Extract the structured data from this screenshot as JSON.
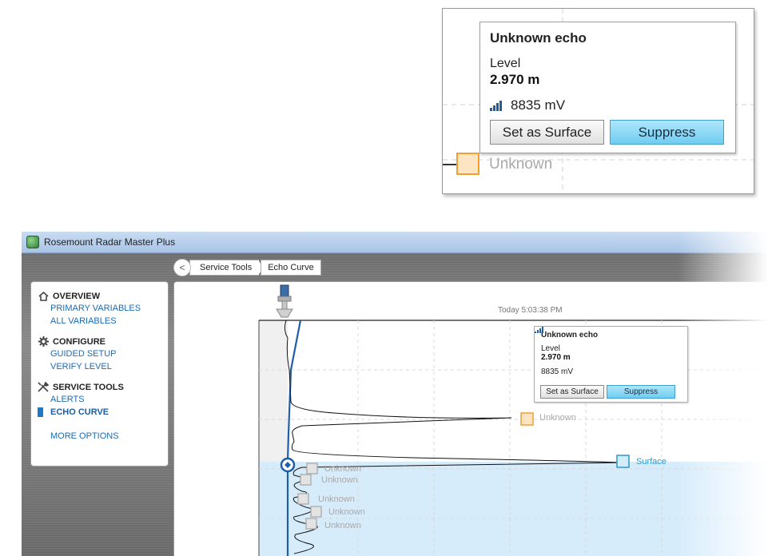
{
  "zoom_tooltip": {
    "title": "Unknown echo",
    "level_label": "Level",
    "level_value": "2.970 m",
    "signal_value": "8835 mV",
    "set_surface_label": "Set as Surface",
    "suppress_label": "Suppress",
    "marker_label": "Unknown"
  },
  "window": {
    "title": "Rosemount Radar Master Plus"
  },
  "breadcrumb": {
    "back_label": "<",
    "items": [
      "Service Tools",
      "Echo Curve"
    ]
  },
  "sidebar": {
    "overview": {
      "heading": "OVERVIEW",
      "links": [
        "PRIMARY VARIABLES",
        "ALL VARIABLES"
      ]
    },
    "configure": {
      "heading": "CONFIGURE",
      "links": [
        "GUIDED SETUP",
        "VERIFY LEVEL"
      ]
    },
    "service_tools": {
      "heading": "SERVICE TOOLS",
      "links": [
        "ALERTS",
        "ECHO CURVE"
      ],
      "active": "ECHO CURVE"
    },
    "more_options": "MORE OPTIONS"
  },
  "echo_chart": {
    "timestamp": "Today 5:03:38 PM",
    "tooltip": {
      "title": "Unknown echo",
      "level_label": "Level",
      "level_value": "2.970 m",
      "signal_value": "8835 mV",
      "set_surface_label": "Set as Surface",
      "suppress_label": "Suppress"
    },
    "echo_labels": {
      "unknown_main": "Unknown",
      "surface": "Surface",
      "unknown_1": "Unknown",
      "unknown_2": "Unknown",
      "unknown_3": "Unknown",
      "unknown_4": "Unknown",
      "unknown_5": "Unknown"
    }
  },
  "colors": {
    "accent": "#1f78c6",
    "surface": "#2a9ac9",
    "unknown_marker": "#f0a030",
    "product_fill": "#d7ecfb",
    "window_chrome": "#a9c4e5"
  }
}
